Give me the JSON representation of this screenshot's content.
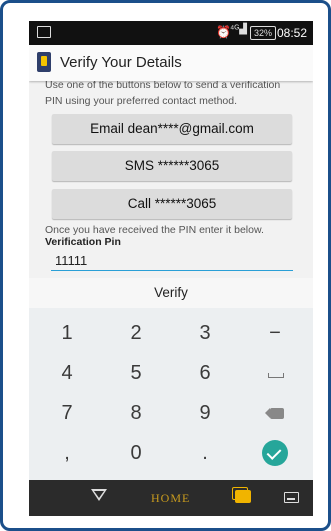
{
  "status_bar": {
    "alarm_glyph": "⏰",
    "signal_glyph": "⁴ᴳ▟",
    "battery": "32%",
    "time": "08:52"
  },
  "app_bar": {
    "title": "Verify Your Details"
  },
  "instructions": {
    "line1": "Use one of the buttons below to send a verification",
    "line2": "PIN using your preferred contact method."
  },
  "buttons": {
    "email": "Email dean****@gmail.com",
    "sms": "SMS ******3065",
    "call": "Call ******3065"
  },
  "pin_section": {
    "hint": "Once you have received the PIN enter it below.",
    "label": "Verification Pin",
    "value": "11111"
  },
  "verify_label": "Verify",
  "keypad": {
    "rows": [
      [
        "1",
        "2",
        "3",
        "−"
      ],
      [
        "4",
        "5",
        "6",
        "space"
      ],
      [
        "7",
        "8",
        "9",
        "backspace"
      ],
      [
        ",",
        "0",
        ".",
        "enter"
      ]
    ]
  },
  "navbar": {
    "home_label": "HOME"
  },
  "colors": {
    "frame": "#1b4f8a",
    "accent": "#2a9fd6",
    "enter_key": "#26a69a",
    "home_text": "#c89b1e",
    "recents": "#f1b400"
  }
}
